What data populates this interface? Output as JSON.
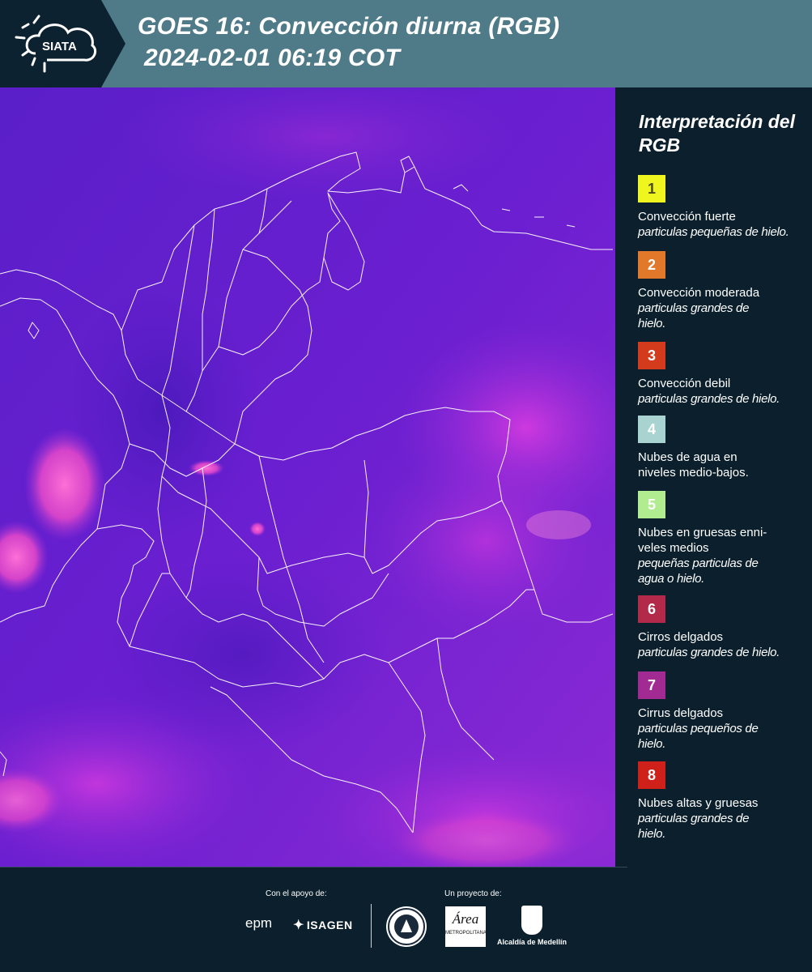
{
  "header": {
    "title_line1": "GOES 16: Convección diurna (RGB)",
    "title_line2": "2024-02-01 06:19 COT",
    "logo_text": "SIATA"
  },
  "legend": {
    "title": "Interpretación del RGB",
    "items": [
      {
        "number": "1",
        "name": "Convección fuerte",
        "description": "particulas pequeñas de hielo.",
        "color": "#eef51f",
        "text_color": "#4a4a1a"
      },
      {
        "number": "2",
        "name": "Convección moderada",
        "description": "particulas grandes de hielo.",
        "color": "#e2782a",
        "text_color": "#ffffff"
      },
      {
        "number": "3",
        "name": "Convección debil",
        "description": "particulas grandes de hielo.",
        "color": "#d43a1c",
        "text_color": "#ffffff"
      },
      {
        "number": "4",
        "name": "Nubes de agua en niveles medio-bajos.",
        "description": "",
        "color": "#a9d3d0",
        "text_color": "#ffffff"
      },
      {
        "number": "5",
        "name": "Nubes en gruesas enni- veles medios",
        "description": "pequeñas particulas de agua o hielo.",
        "color": "#b2ec91",
        "text_color": "#ffffff"
      },
      {
        "number": "6",
        "name": "Cirros delgados",
        "description": "particulas grandes de hielo.",
        "color": "#b3294a",
        "text_color": "#ffffff"
      },
      {
        "number": "7",
        "name": "Cirrus delgados",
        "description": "particulas pequeños de hielo.",
        "color": "#a22b93",
        "text_color": "#ffffff"
      },
      {
        "number": "8",
        "name": "Nubes altas y gruesas",
        "description": "particulas grandes de hielo.",
        "color": "#d0201a",
        "text_color": "#ffffff"
      }
    ]
  },
  "footer": {
    "support_caption": "Con el apoyo de:",
    "project_caption": "Un proyecto de:",
    "epm": "epm",
    "isagen": "ISAGEN",
    "area_name": "Área",
    "area_sub": "METROPOLITANA",
    "alcaldia": "Alcaldía de Medellín"
  },
  "colors": {
    "header_bg": "#4f7a88",
    "page_bg": "#0b1f2c",
    "map_base": "#5a1ec8"
  }
}
